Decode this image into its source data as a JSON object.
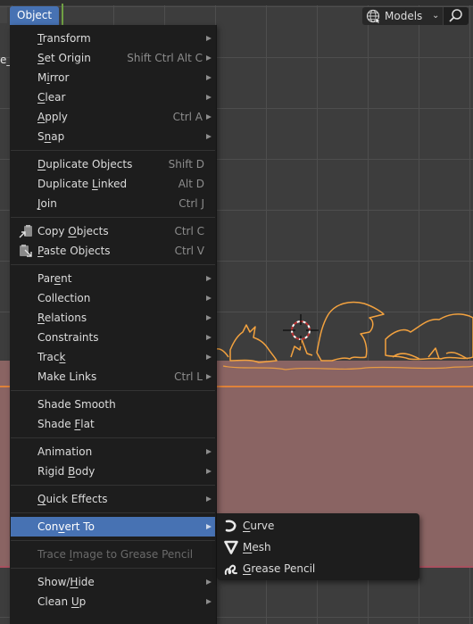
{
  "header": {
    "active_menu": "Object",
    "left_stub_text": "e_"
  },
  "workspace_selector": {
    "label": "Models",
    "icon": "globe-cursor-icon",
    "dropdown_icon": "chevron-down-icon",
    "search_icon": "search-icon"
  },
  "menu": {
    "groups": [
      [
        {
          "label": "Transform",
          "underline": 0,
          "shortcut": "",
          "submenu": true
        },
        {
          "label": "Set Origin",
          "underline": 0,
          "shortcut": "Shift Ctrl Alt C",
          "submenu": true
        },
        {
          "label": "Mirror",
          "underline": 1,
          "shortcut": "",
          "submenu": true
        },
        {
          "label": "Clear",
          "underline": 0,
          "shortcut": "",
          "submenu": true
        },
        {
          "label": "Apply",
          "underline": 0,
          "shortcut": "Ctrl A",
          "submenu": true
        },
        {
          "label": "Snap",
          "underline": 1,
          "shortcut": "",
          "submenu": true
        }
      ],
      [
        {
          "label": "Duplicate Objects",
          "underline": 0,
          "shortcut": "Shift D",
          "submenu": false
        },
        {
          "label": "Duplicate Linked",
          "underline": 10,
          "shortcut": "Alt D",
          "submenu": false
        },
        {
          "label": "Join",
          "underline": 0,
          "shortcut": "Ctrl J",
          "submenu": false
        }
      ],
      [
        {
          "label": "Copy Objects",
          "underline": 5,
          "shortcut": "Ctrl C",
          "submenu": false,
          "icon": "copy-icon"
        },
        {
          "label": "Paste Objects",
          "underline": 0,
          "shortcut": "Ctrl V",
          "submenu": false,
          "icon": "paste-icon"
        }
      ],
      [
        {
          "label": "Parent",
          "underline": 3,
          "shortcut": "",
          "submenu": true
        },
        {
          "label": "Collection",
          "underline": -1,
          "shortcut": "",
          "submenu": true
        },
        {
          "label": "Relations",
          "underline": 0,
          "shortcut": "",
          "submenu": true
        },
        {
          "label": "Constraints",
          "underline": -1,
          "shortcut": "",
          "submenu": true
        },
        {
          "label": "Track",
          "underline": 4,
          "shortcut": "",
          "submenu": true
        },
        {
          "label": "Make Links",
          "underline": -1,
          "shortcut": "Ctrl L",
          "submenu": true
        }
      ],
      [
        {
          "label": "Shade Smooth",
          "underline": -1,
          "shortcut": "",
          "submenu": false
        },
        {
          "label": "Shade Flat",
          "underline": 6,
          "shortcut": "",
          "submenu": false
        }
      ],
      [
        {
          "label": "Animation",
          "underline": -1,
          "shortcut": "",
          "submenu": true
        },
        {
          "label": "Rigid Body",
          "underline": 6,
          "shortcut": "",
          "submenu": true
        }
      ],
      [
        {
          "label": "Quick Effects",
          "underline": 0,
          "shortcut": "",
          "submenu": true
        }
      ],
      [
        {
          "label": "Convert To",
          "underline": 3,
          "shortcut": "",
          "submenu": true,
          "highlighted": true
        }
      ],
      [
        {
          "label": "Trace Image to Grease Pencil",
          "underline": 6,
          "shortcut": "",
          "submenu": false,
          "disabled": true
        }
      ],
      [
        {
          "label": "Show/Hide",
          "underline": 5,
          "shortcut": "",
          "submenu": true
        },
        {
          "label": "Clean Up",
          "underline": 6,
          "shortcut": "",
          "submenu": true
        }
      ]
    ]
  },
  "convert_submenu": {
    "items": [
      {
        "label": "Curve",
        "icon": "curve-icon"
      },
      {
        "label": "Mesh",
        "icon": "mesh-icon"
      },
      {
        "label": "Grease Pencil",
        "icon": "grease-pencil-icon"
      }
    ]
  },
  "colors": {
    "accent": "#4772b3",
    "selection_outline": "#f0a040",
    "plane": "#8a6463"
  }
}
